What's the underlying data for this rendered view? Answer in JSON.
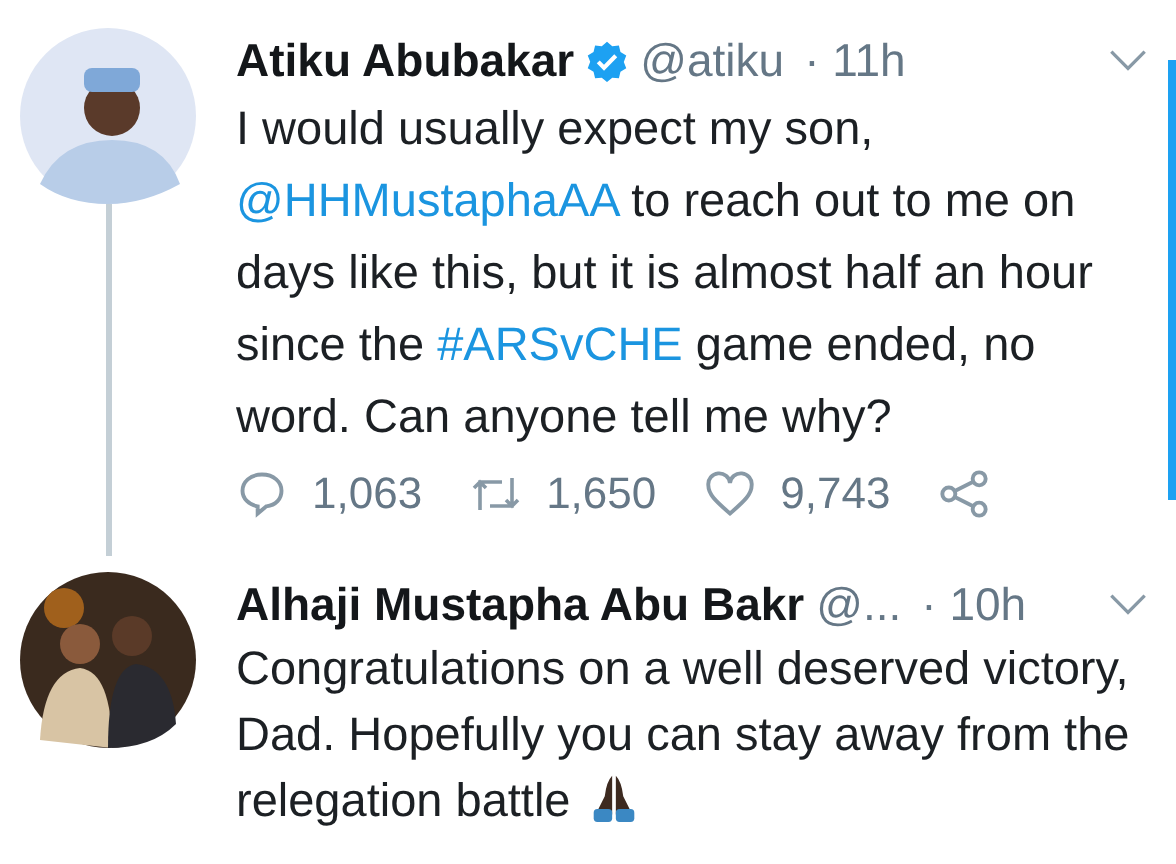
{
  "tweets": [
    {
      "name": "Atiku Abubakar",
      "verified": true,
      "handle": "@atiku",
      "time": "· 11h",
      "avatar": {
        "kind": "picture"
      },
      "body": [
        {
          "kind": "text",
          "text": "I would usually expect my son, "
        },
        {
          "kind": "link",
          "text": "@HHMustaphaAA"
        },
        {
          "kind": "text",
          "text": " to reach out to me on days like this, but it is almost half an hour since the "
        },
        {
          "kind": "link",
          "text": "#ARSvCHE"
        },
        {
          "kind": "text",
          "text": " game ended, no word. Can anyone tell me why?"
        }
      ],
      "emoji": false,
      "actions": {
        "replies": "1,063",
        "retweets": "1,650",
        "likes": "9,743"
      }
    },
    {
      "name": "Alhaji Mustapha Abu Bakr",
      "verified": false,
      "handle": "@...",
      "time": "· 10h",
      "avatar": {
        "kind": "picture"
      },
      "body": [
        {
          "kind": "text",
          "text": "Congratulations on a well deserved victory, Dad. Hopefully you can stay away from the relegation battle"
        }
      ],
      "emoji": true
    }
  ]
}
